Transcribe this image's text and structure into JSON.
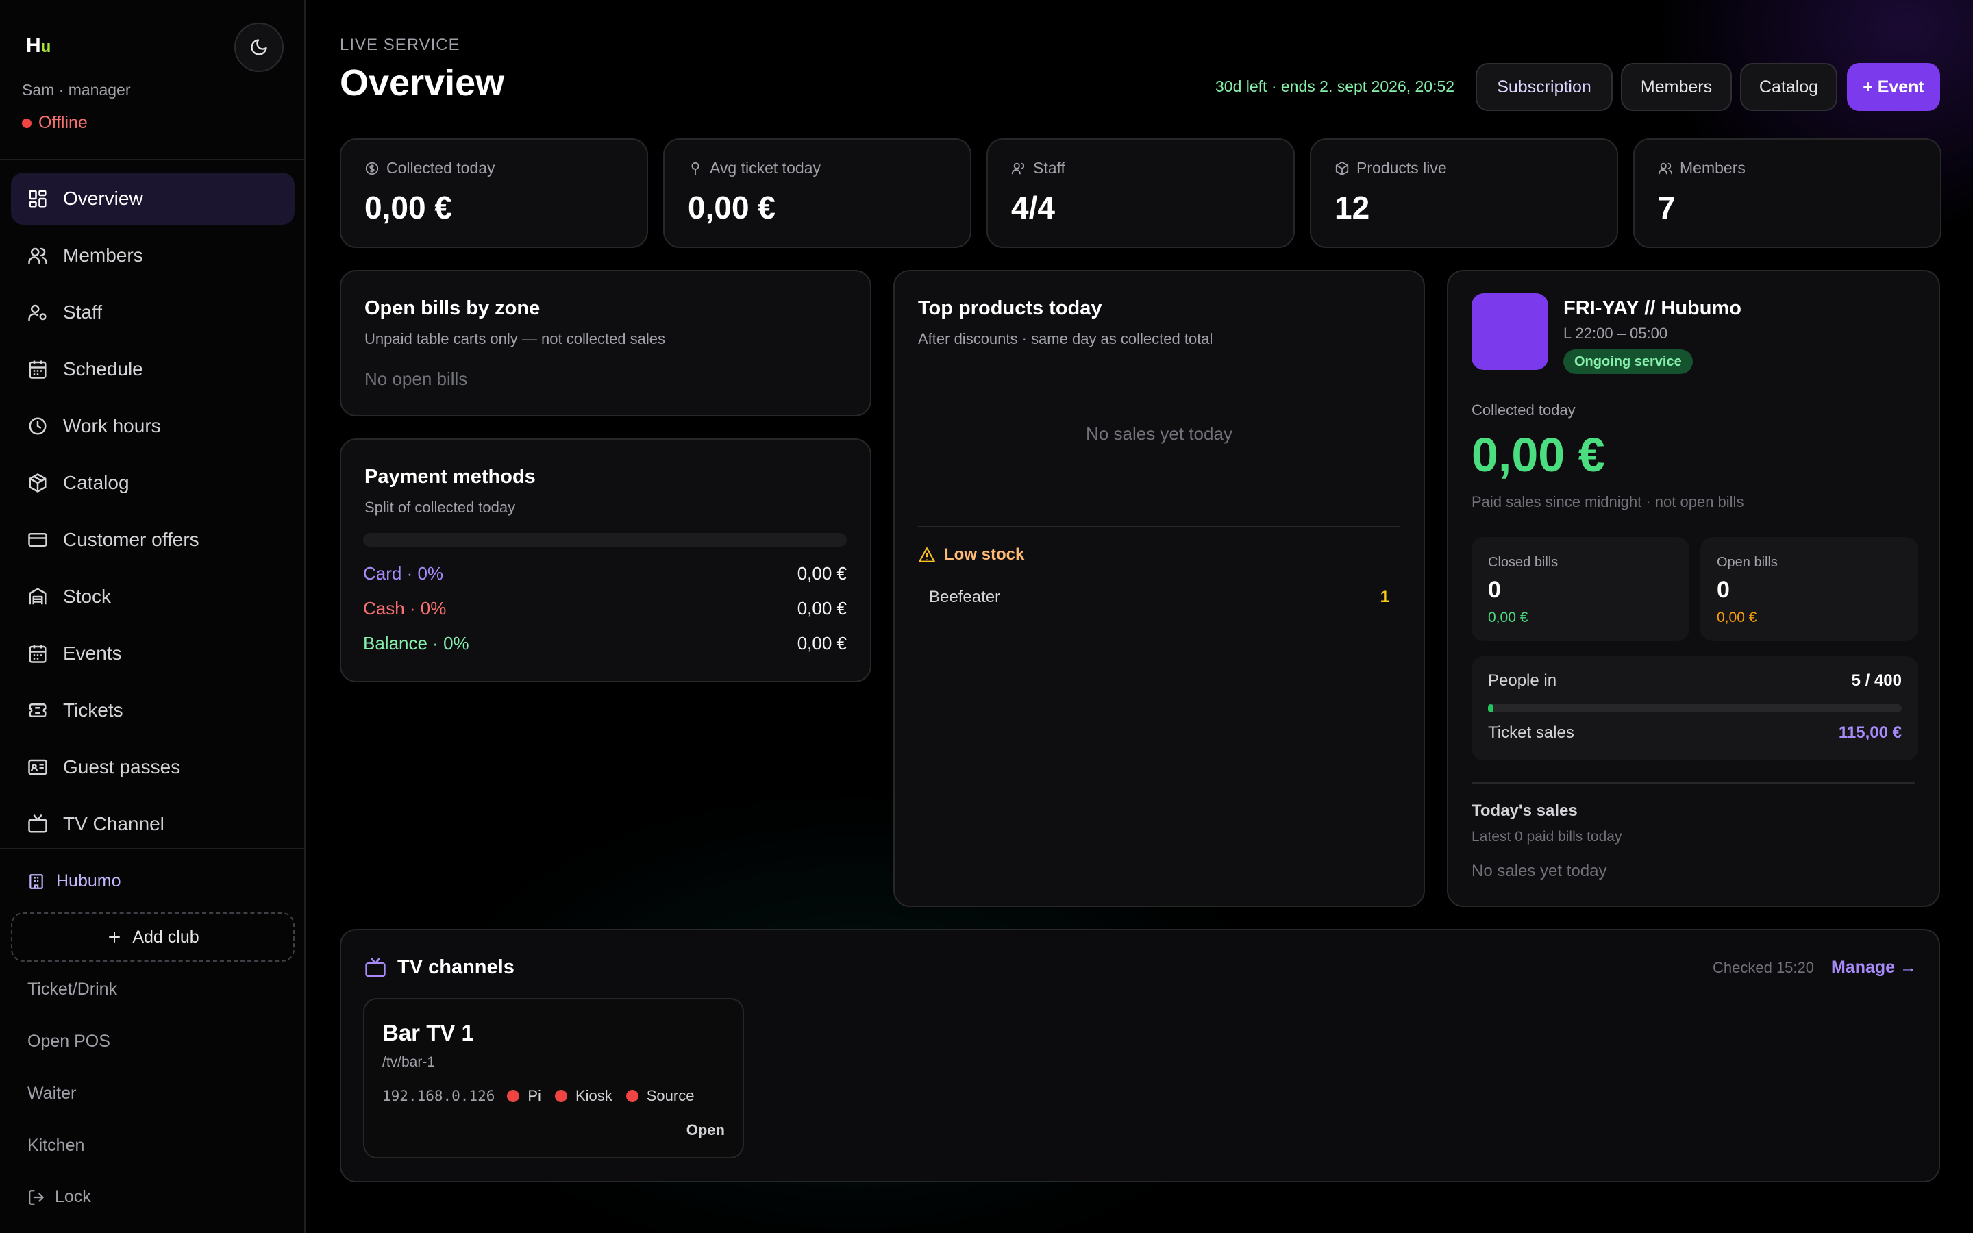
{
  "sidebar": {
    "logo": {
      "h": "H",
      "u": "u"
    },
    "user_line": "Sam · manager",
    "status": "Offline",
    "nav": [
      {
        "label": "Overview",
        "icon": "grid-icon"
      },
      {
        "label": "Members",
        "icon": "users-icon"
      },
      {
        "label": "Staff",
        "icon": "staff-icon"
      },
      {
        "label": "Schedule",
        "icon": "calendar-icon"
      },
      {
        "label": "Work hours",
        "icon": "clock-icon"
      },
      {
        "label": "Catalog",
        "icon": "box-icon"
      },
      {
        "label": "Customer offers",
        "icon": "credit-card-icon"
      },
      {
        "label": "Stock",
        "icon": "warehouse-icon"
      },
      {
        "label": "Events",
        "icon": "calendar-icon"
      },
      {
        "label": "Tickets",
        "icon": "ticket-icon"
      },
      {
        "label": "Guest passes",
        "icon": "id-card-icon"
      },
      {
        "label": "TV Channel",
        "icon": "tv-icon"
      }
    ],
    "club": "Hubumo",
    "add_club": "Add club",
    "links": [
      "Ticket/Drink",
      "Open POS",
      "Waiter",
      "Kitchen"
    ],
    "lock": "Lock"
  },
  "header": {
    "eyebrow": "LIVE SERVICE",
    "title": "Overview",
    "subscription_note": "30d left · ends 2. sept 2026, 20:52",
    "buttons": {
      "subscription": "Subscription",
      "members": "Members",
      "catalog": "Catalog",
      "event": "+ Event"
    }
  },
  "stats": [
    {
      "label": "Collected today",
      "value": "0,00 €",
      "icon": "coin-icon"
    },
    {
      "label": "Avg ticket today",
      "value": "0,00 €",
      "icon": "award-icon"
    },
    {
      "label": "Staff",
      "value": "4/4",
      "icon": "staff-icon"
    },
    {
      "label": "Products live",
      "value": "12",
      "icon": "box-icon"
    },
    {
      "label": "Members",
      "value": "7",
      "icon": "users-icon"
    }
  ],
  "open_bills": {
    "title": "Open bills by zone",
    "subtitle": "Unpaid table carts only — not collected sales",
    "empty": "No open bills"
  },
  "payment_methods": {
    "title": "Payment methods",
    "subtitle": "Split of collected today",
    "rows": [
      {
        "label": "Card · 0%",
        "value": "0,00 €",
        "color": "#a78bfa"
      },
      {
        "label": "Cash · 0%",
        "value": "0,00 €",
        "color": "#f87171"
      },
      {
        "label": "Balance · 0%",
        "value": "0,00 €",
        "color": "#86efac"
      }
    ]
  },
  "top_products": {
    "title": "Top products today",
    "subtitle": "After discounts · same day as collected total",
    "empty": "No sales yet today",
    "low_stock_title": "Low stock",
    "low_stock": [
      {
        "name": "Beefeater",
        "qty": "1"
      }
    ]
  },
  "event": {
    "name": "FRI-YAY // Hubumo",
    "time": "L 22:00 – 05:00",
    "badge": "Ongoing service",
    "collected_label": "Collected today",
    "collected_value": "0,00 €",
    "collected_note": "Paid sales since midnight · not open bills",
    "closed_bills": {
      "label": "Closed bills",
      "count": "0",
      "amount": "0,00 €"
    },
    "open_bills": {
      "label": "Open bills",
      "count": "0",
      "amount": "0,00 €"
    },
    "people_in_label": "People in",
    "people_in_value": "5 / 400",
    "people_in_fraction": 0.0125,
    "ticket_sales_label": "Ticket sales",
    "ticket_sales_value": "115,00 €",
    "todays_sales_title": "Today's sales",
    "todays_sales_sub": "Latest 0 paid bills today",
    "todays_sales_empty": "No sales yet today"
  },
  "tv": {
    "title": "TV channels",
    "checked": "Checked 15:20",
    "manage": "Manage →",
    "channels": [
      {
        "name": "Bar TV 1",
        "path": "/tv/bar-1",
        "ip": "192.168.0.126",
        "status": [
          "Pi",
          "Kiosk",
          "Source"
        ],
        "open": "Open"
      }
    ]
  },
  "colors": {
    "accent": "#7c3aed",
    "success": "#4ade80",
    "danger": "#ef4444",
    "warning": "#facc15"
  }
}
